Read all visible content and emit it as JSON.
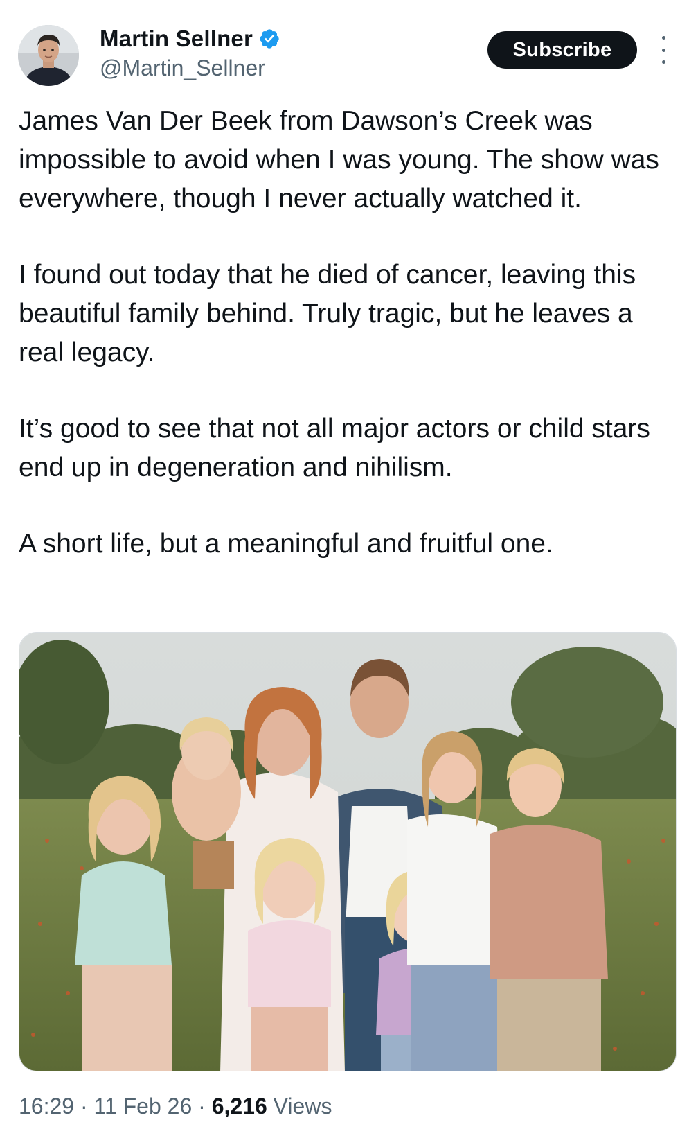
{
  "author": {
    "display_name": "Martin Sellner",
    "handle": "@Martin_Sellner",
    "verified": true,
    "avatar_icon": "profile-photo"
  },
  "header": {
    "subscribe_label": "Subscribe",
    "more_icon": "more-vertical-icon"
  },
  "tweet": {
    "paragraphs": [
      "James Van Der Beek from Dawson’s Creek was impossible to avoid when I was young. The show was everywhere, though I never actually watched it.",
      "I found out today that he died of cancer, leaving this beautiful family behind. Truly tragic, but he leaves a real legacy.",
      "It’s good to see that not all major actors or child stars end up in degeneration and nihilism.",
      "A short life, but a meaningful and fruitful one."
    ]
  },
  "meta": {
    "time": "16:29",
    "separator": "·",
    "date": "11 Feb 26",
    "views_count": "6,216",
    "views_label": "Views"
  },
  "colors": {
    "text_primary": "#0f1419",
    "text_secondary": "#536471",
    "verified_blue": "#1d9bf0",
    "button_bg": "#0f1419"
  }
}
